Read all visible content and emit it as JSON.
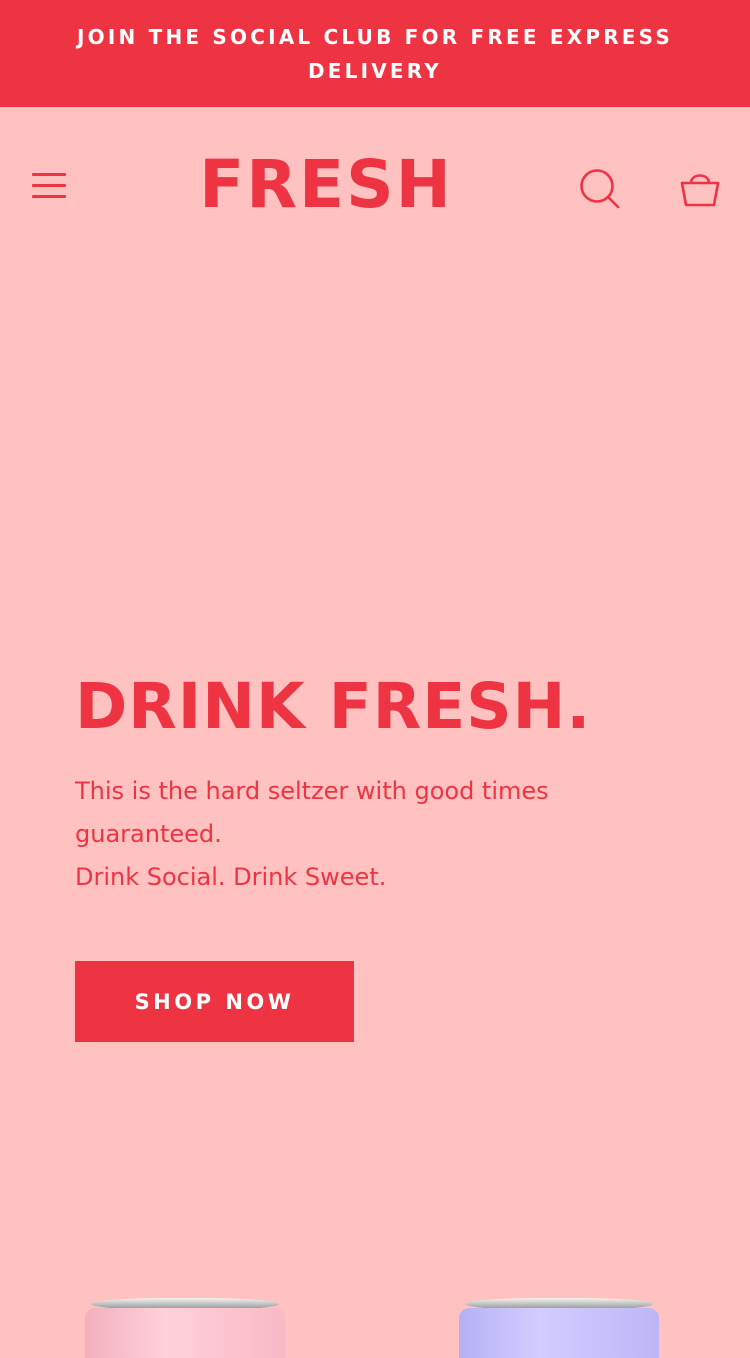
{
  "promo": {
    "text": "JOIN THE SOCIAL CLUB FOR FREE EXPRESS DELIVERY"
  },
  "header": {
    "logo": "FRESH",
    "menu_icon": "hamburger-menu-icon",
    "search_icon": "search-icon",
    "cart_icon": "shopping-bag-icon"
  },
  "hero": {
    "title": "DRINK FRESH.",
    "description_line1": "This is the hard seltzer with good times guaranteed.",
    "description_line2": "Drink Social. Drink Sweet.",
    "cta_label": "SHOP NOW"
  },
  "products": [
    {
      "icon": "seltzer-can",
      "color": "#FFC9D4"
    },
    {
      "icon": "seltzer-can",
      "color": "#C9C4FF"
    }
  ],
  "colors": {
    "brand_red": "#EE3442",
    "background_pink": "#FFC2C1",
    "promo_text": "#FFFFFF"
  }
}
